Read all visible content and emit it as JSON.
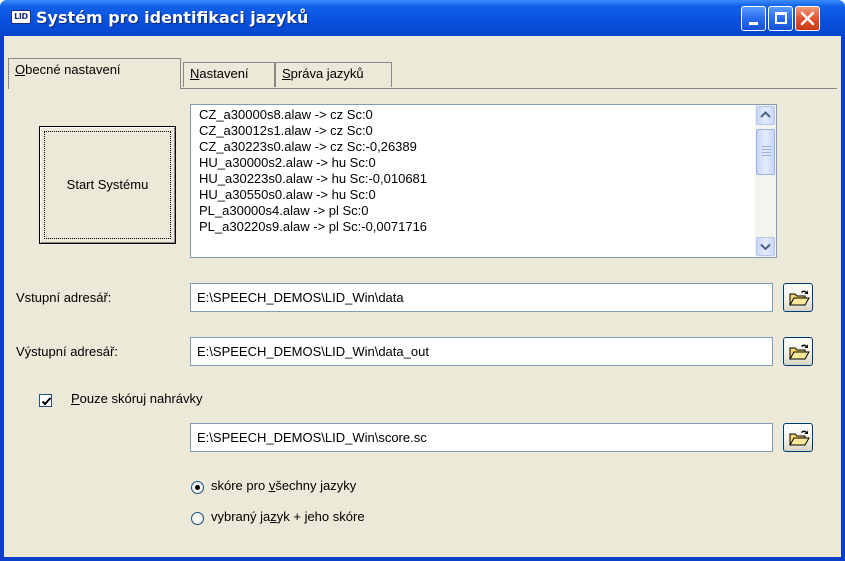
{
  "window": {
    "icon_text": "LID",
    "title": "Systém pro identifikaci jazyků"
  },
  "tabs": [
    {
      "pre": "",
      "acc": "O",
      "post": "becné nastavení",
      "active": true
    },
    {
      "pre": "",
      "acc": "N",
      "post": "astavení",
      "active": false
    },
    {
      "pre": "",
      "acc": "S",
      "post": "práva jazyků",
      "active": false
    }
  ],
  "start_button": {
    "label": "Start Systému"
  },
  "log_list": {
    "items": [
      "CZ_a30000s8.alaw -> cz  Sc:0",
      "CZ_a30012s1.alaw -> cz  Sc:0",
      "CZ_a30223s0.alaw -> cz  Sc:-0,26389",
      "HU_a30000s2.alaw -> hu  Sc:0",
      "HU_a30223s0.alaw -> hu  Sc:-0,010681",
      "HU_a30550s0.alaw -> hu  Sc:0",
      "PL_a30000s4.alaw -> pl  Sc:0",
      "PL_a30220s9.alaw -> pl  Sc:-0,0071716"
    ]
  },
  "input_dir": {
    "label": "Vstupní adresář:",
    "value": "E:\\SPEECH_DEMOS\\LID_Win\\data"
  },
  "output_dir": {
    "label": "Výstupní adresář:",
    "value": "E:\\SPEECH_DEMOS\\LID_Win\\data_out"
  },
  "score_only": {
    "checked": true,
    "label_acc": "P",
    "label_rest": "ouze skóruj nahrávky"
  },
  "score_file": {
    "value": "E:\\SPEECH_DEMOS\\LID_Win\\score.sc"
  },
  "radio_all": {
    "pre": "skóre pro ",
    "acc": "v",
    "post": "šechny jazyky",
    "selected": true
  },
  "radio_selected": {
    "pre": "vybraný ja",
    "acc": "z",
    "post": "yk + jeho skóre",
    "selected": false
  }
}
